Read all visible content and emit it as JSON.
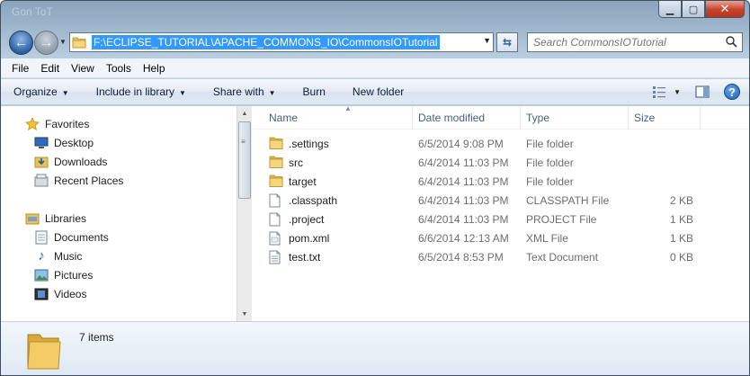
{
  "window": {
    "title": "Gon ToT"
  },
  "caption_buttons": {
    "minimize": "▁",
    "maximize": "▢",
    "close": "✕"
  },
  "address": {
    "path": "F:\\ECLIPSE_TUTORIAL\\APACHE_COMMONS_IO\\CommonsIOTutorial",
    "search_placeholder": "Search CommonsIOTutorial"
  },
  "menu": [
    "File",
    "Edit",
    "View",
    "Tools",
    "Help"
  ],
  "commands": {
    "organize": "Organize",
    "include_in_library": "Include in library",
    "share_with": "Share with",
    "burn": "Burn",
    "new_folder": "New folder"
  },
  "nav_pane": {
    "favorites": {
      "label": "Favorites",
      "items": [
        "Desktop",
        "Downloads",
        "Recent Places"
      ]
    },
    "libraries": {
      "label": "Libraries",
      "items": [
        "Documents",
        "Music",
        "Pictures",
        "Videos"
      ]
    }
  },
  "columns": {
    "name": "Name",
    "date_modified": "Date modified",
    "type": "Type",
    "size": "Size"
  },
  "files": [
    {
      "name": ".settings",
      "date": "6/5/2014 9:08 PM",
      "type": "File folder",
      "size": "",
      "icon": "folder-icon"
    },
    {
      "name": "src",
      "date": "6/4/2014 11:03 PM",
      "type": "File folder",
      "size": "",
      "icon": "folder-icon"
    },
    {
      "name": "target",
      "date": "6/4/2014 11:03 PM",
      "type": "File folder",
      "size": "",
      "icon": "folder-icon"
    },
    {
      "name": ".classpath",
      "date": "6/4/2014 11:03 PM",
      "type": "CLASSPATH File",
      "size": "2 KB",
      "icon": "file-icon"
    },
    {
      "name": ".project",
      "date": "6/4/2014 11:03 PM",
      "type": "PROJECT File",
      "size": "1 KB",
      "icon": "file-icon"
    },
    {
      "name": "pom.xml",
      "date": "6/6/2014 12:13 AM",
      "type": "XML File",
      "size": "1 KB",
      "icon": "xml-file-icon"
    },
    {
      "name": "test.txt",
      "date": "6/5/2014 8:53 PM",
      "type": "Text Document",
      "size": "0 KB",
      "icon": "text-file-icon"
    }
  ],
  "status": {
    "item_count": "7 items"
  },
  "colors": {
    "accent": "#3399ff",
    "folder": "#e8c25c",
    "header_text": "#4c607a"
  }
}
